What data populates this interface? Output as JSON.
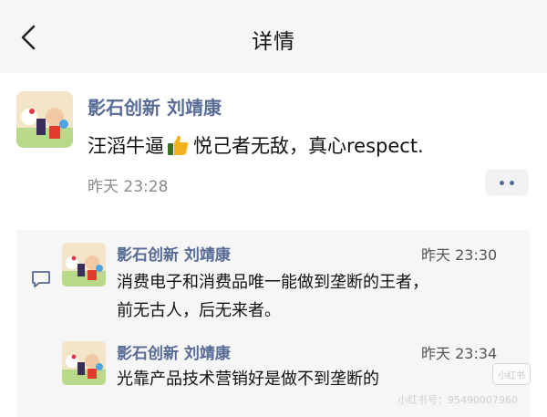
{
  "header": {
    "title": "详情",
    "back_icon": "chevron-left-icon"
  },
  "post": {
    "author": "影石创新 刘靖康",
    "text_before": "汪滔牛逼",
    "emoji": "thumbs-up-icon",
    "text_after": " 悦己者无敌，真心respect.",
    "time": "昨天 23:28"
  },
  "comments": [
    {
      "author": "影石创新 刘靖康",
      "time": "昨天 23:30",
      "lines": [
        "消费电子和消费品唯一能做到垄断的王者，",
        "前无古人，后无来者。"
      ]
    },
    {
      "author": "影石创新 刘靖康",
      "time": "昨天 23:34",
      "lines": [
        "光靠产品技术营销好是做不到垄断的"
      ]
    }
  ],
  "watermark": {
    "badge": "小红书",
    "text": "小红书号：95490007960"
  },
  "colors": {
    "link": "#576b95",
    "panel": "#f6f6f6",
    "header": "#f6f6f6",
    "thumb": "#f2b21b"
  }
}
